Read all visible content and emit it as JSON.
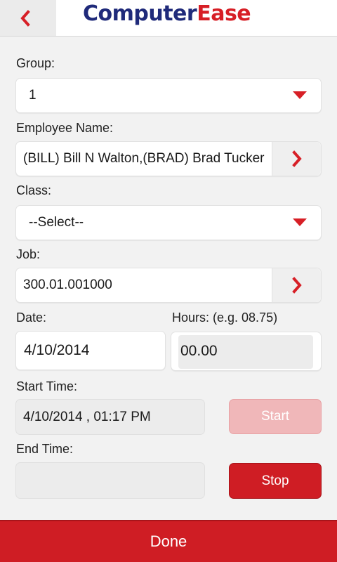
{
  "header": {
    "logo_primary": "Computer",
    "logo_accent": "Ease",
    "brand_blue": "#1f2a7a",
    "brand_red": "#d71f26"
  },
  "form": {
    "group_label": "Group:",
    "group_value": "1",
    "employee_label": "Employee Name:",
    "employee_value": "(BILL) Bill N Walton,(BRAD) Brad Tucker",
    "class_label": "Class:",
    "class_value": "--Select--",
    "job_label": "Job:",
    "job_value": "300.01.001000",
    "date_label": "Date:",
    "date_value": "4/10/2014",
    "hours_label": "Hours: (e.g. 08.75)",
    "hours_value": "00.00",
    "start_time_label": "Start Time:",
    "start_time_value": "4/10/2014 , 01:17 PM",
    "start_button": "Start",
    "end_time_label": "End Time:",
    "end_time_value": "",
    "stop_button": "Stop"
  },
  "footer": {
    "done_label": "Done"
  }
}
